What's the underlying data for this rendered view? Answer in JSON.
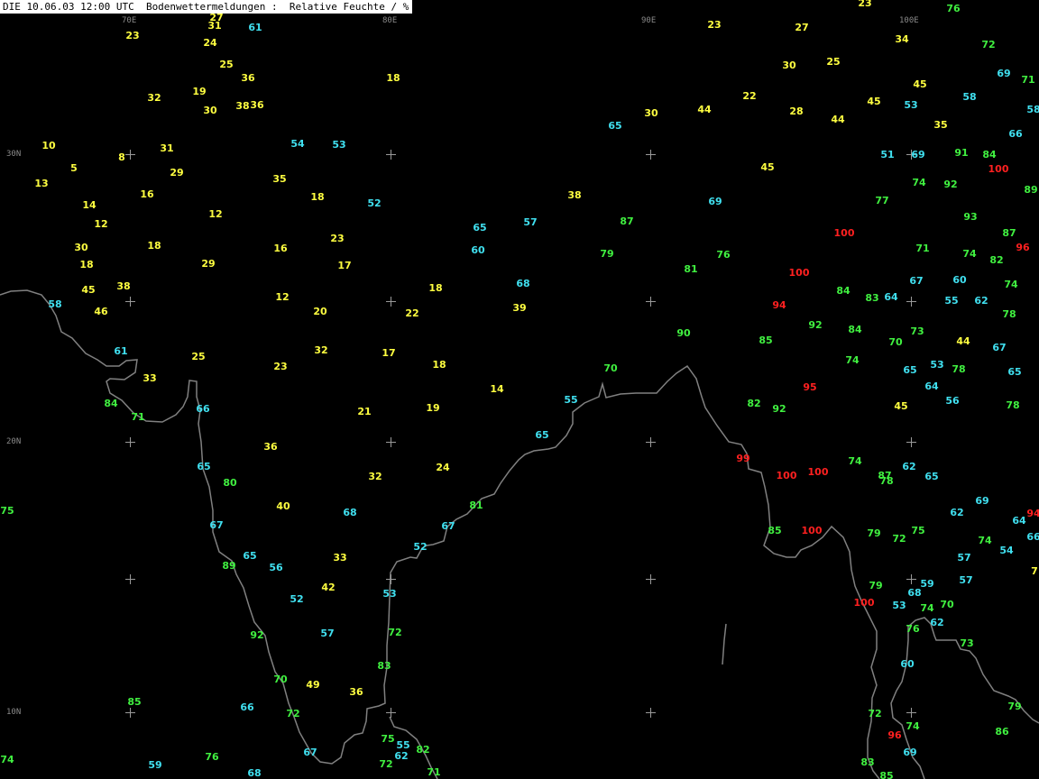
{
  "title": "DIE 10.06.03 12:00 UTC  Bodenwettermeldungen :  Relative Feuchte / %",
  "colors": {
    "background": "#000000",
    "coast": "#808080",
    "grid": "#9a9a9a",
    "label": "#8a8a8a",
    "low": "#ffff40",
    "mid": "#40e0f0",
    "high": "#40f040",
    "sat": "#ff2020"
  },
  "grid_labels": {
    "lon": [
      "70E",
      "80E",
      "90E",
      "100E"
    ],
    "lat": [
      "30N",
      "20N",
      "10N"
    ]
  },
  "observations": [
    [
      "23",
      147,
      40
    ],
    [
      "31",
      238,
      29
    ],
    [
      "27",
      240,
      20
    ],
    [
      "24",
      233,
      48
    ],
    [
      "61",
      283,
      31
    ],
    [
      "25",
      251,
      72
    ],
    [
      "36",
      275,
      87
    ],
    [
      "18",
      436,
      87
    ],
    [
      "32",
      171,
      109
    ],
    [
      "19",
      221,
      102
    ],
    [
      "30",
      233,
      123
    ],
    [
      "38",
      269,
      118
    ],
    [
      "36",
      285,
      117
    ],
    [
      "10",
      54,
      162
    ],
    [
      "5",
      82,
      187
    ],
    [
      "8",
      135,
      175
    ],
    [
      "31",
      185,
      165
    ],
    [
      "29",
      196,
      192
    ],
    [
      "54",
      330,
      160
    ],
    [
      "53",
      376,
      161
    ],
    [
      "13",
      46,
      204
    ],
    [
      "16",
      163,
      216
    ],
    [
      "35",
      310,
      199
    ],
    [
      "18",
      352,
      219
    ],
    [
      "52",
      415,
      226
    ],
    [
      "14",
      99,
      228
    ],
    [
      "12",
      112,
      249
    ],
    [
      "12",
      239,
      238
    ],
    [
      "23",
      374,
      265
    ],
    [
      "30",
      90,
      275
    ],
    [
      "18",
      171,
      273
    ],
    [
      "16",
      311,
      276
    ],
    [
      "18",
      96,
      294
    ],
    [
      "29",
      231,
      293
    ],
    [
      "17",
      382,
      295
    ],
    [
      "45",
      98,
      322
    ],
    [
      "38",
      137,
      318
    ],
    [
      "18",
      483,
      320
    ],
    [
      "12",
      313,
      330
    ],
    [
      "58",
      61,
      338
    ],
    [
      "46",
      112,
      346
    ],
    [
      "20",
      355,
      346
    ],
    [
      "22",
      457,
      348
    ],
    [
      "61",
      134,
      390
    ],
    [
      "25",
      220,
      396
    ],
    [
      "32",
      356,
      389
    ],
    [
      "17",
      431,
      392
    ],
    [
      "33",
      166,
      420
    ],
    [
      "23",
      311,
      407
    ],
    [
      "18",
      487,
      405
    ],
    [
      "84",
      123,
      448
    ],
    [
      "71",
      153,
      463
    ],
    [
      "66",
      225,
      454
    ],
    [
      "21",
      404,
      457
    ],
    [
      "19",
      480,
      453
    ],
    [
      "14",
      551,
      432
    ],
    [
      "36",
      300,
      496
    ],
    [
      "65",
      226,
      518
    ],
    [
      "80",
      255,
      536
    ],
    [
      "32",
      416,
      529
    ],
    [
      "24",
      491,
      519
    ],
    [
      "40",
      314,
      562
    ],
    [
      "68",
      388,
      569
    ],
    [
      "67",
      240,
      583
    ],
    [
      "65",
      277,
      617
    ],
    [
      "56",
      306,
      630
    ],
    [
      "33",
      377,
      619
    ],
    [
      "89",
      254,
      628
    ],
    [
      "42",
      364,
      652
    ],
    [
      "52",
      329,
      665
    ],
    [
      "53",
      432,
      659
    ],
    [
      "92",
      285,
      705
    ],
    [
      "57",
      363,
      703
    ],
    [
      "72",
      438,
      702
    ],
    [
      "83",
      426,
      739
    ],
    [
      "70",
      311,
      754
    ],
    [
      "49",
      347,
      760
    ],
    [
      "36",
      395,
      768
    ],
    [
      "72",
      325,
      792
    ],
    [
      "67",
      344,
      835
    ],
    [
      "75",
      430,
      820
    ],
    [
      "55",
      447,
      827
    ],
    [
      "62",
      445,
      839
    ],
    [
      "82",
      469,
      832
    ],
    [
      "72",
      428,
      848
    ],
    [
      "71",
      481,
      857
    ],
    [
      "68",
      282,
      858
    ],
    [
      "66",
      274,
      785
    ],
    [
      "85",
      149,
      779
    ],
    [
      "76",
      235,
      840
    ],
    [
      "59",
      172,
      849
    ],
    [
      "74",
      8,
      843
    ],
    [
      "75",
      8,
      567
    ],
    [
      "23",
      959,
      4
    ],
    [
      "76",
      1057,
      10
    ],
    [
      "23",
      792,
      28
    ],
    [
      "27",
      889,
      31
    ],
    [
      "34",
      1000,
      44
    ],
    [
      "72",
      1096,
      50
    ],
    [
      "30",
      875,
      73
    ],
    [
      "25",
      924,
      69
    ],
    [
      "69",
      1113,
      82
    ],
    [
      "71",
      1140,
      89
    ],
    [
      "45",
      1020,
      94
    ],
    [
      "22",
      831,
      107
    ],
    [
      "44",
      781,
      122
    ],
    [
      "30",
      722,
      126
    ],
    [
      "28",
      883,
      124
    ],
    [
      "44",
      929,
      133
    ],
    [
      "45",
      969,
      113
    ],
    [
      "53",
      1010,
      117
    ],
    [
      "58",
      1075,
      108
    ],
    [
      "35",
      1043,
      139
    ],
    [
      "65",
      682,
      140
    ],
    [
      "66",
      1126,
      149
    ],
    [
      "58",
      1146,
      122
    ],
    [
      "51",
      984,
      172
    ],
    [
      "69",
      1018,
      172
    ],
    [
      "91",
      1066,
      170
    ],
    [
      "84",
      1097,
      172
    ],
    [
      "100",
      1107,
      188
    ],
    [
      "45",
      851,
      186
    ],
    [
      "74",
      1019,
      203
    ],
    [
      "92",
      1054,
      205
    ],
    [
      "89",
      1143,
      211
    ],
    [
      "69",
      793,
      224
    ],
    [
      "77",
      978,
      223
    ],
    [
      "38",
      637,
      217
    ],
    [
      "87",
      695,
      246
    ],
    [
      "57",
      588,
      247
    ],
    [
      "65",
      532,
      253
    ],
    [
      "93",
      1076,
      241
    ],
    [
      "100",
      936,
      259
    ],
    [
      "87",
      1119,
      259
    ],
    [
      "96",
      1134,
      275
    ],
    [
      "60",
      530,
      278
    ],
    [
      "79",
      673,
      282
    ],
    [
      "76",
      802,
      283
    ],
    [
      "71",
      1023,
      276
    ],
    [
      "74",
      1075,
      282
    ],
    [
      "82",
      1105,
      289
    ],
    [
      "81",
      766,
      299
    ],
    [
      "100",
      886,
      303
    ],
    [
      "67",
      1016,
      312
    ],
    [
      "60",
      1064,
      311
    ],
    [
      "74",
      1121,
      316
    ],
    [
      "68",
      580,
      315
    ],
    [
      "84",
      935,
      323
    ],
    [
      "83",
      967,
      331
    ],
    [
      "64",
      988,
      330
    ],
    [
      "55",
      1055,
      334
    ],
    [
      "62",
      1088,
      334
    ],
    [
      "94",
      864,
      339
    ],
    [
      "39",
      576,
      342
    ],
    [
      "78",
      1119,
      349
    ],
    [
      "92",
      904,
      361
    ],
    [
      "84",
      948,
      366
    ],
    [
      "73",
      1017,
      368
    ],
    [
      "90",
      758,
      370
    ],
    [
      "85",
      849,
      378
    ],
    [
      "70",
      993,
      380
    ],
    [
      "44",
      1068,
      379
    ],
    [
      "67",
      1108,
      386
    ],
    [
      "74",
      945,
      400
    ],
    [
      "65",
      1009,
      411
    ],
    [
      "53",
      1039,
      405
    ],
    [
      "78",
      1063,
      410
    ],
    [
      "65",
      1125,
      413
    ],
    [
      "70",
      677,
      409
    ],
    [
      "95",
      898,
      430
    ],
    [
      "64",
      1033,
      429
    ],
    [
      "56",
      1056,
      445
    ],
    [
      "78",
      1123,
      450
    ],
    [
      "55",
      633,
      444
    ],
    [
      "82",
      836,
      448
    ],
    [
      "92",
      864,
      454
    ],
    [
      "45",
      999,
      451
    ],
    [
      "65",
      601,
      483
    ],
    [
      "99",
      824,
      509
    ],
    [
      "100",
      872,
      528
    ],
    [
      "100",
      907,
      524
    ],
    [
      "74",
      948,
      512
    ],
    [
      "87",
      981,
      528
    ],
    [
      "78",
      983,
      534
    ],
    [
      "62",
      1008,
      518
    ],
    [
      "65",
      1033,
      529
    ],
    [
      "81",
      528,
      561
    ],
    [
      "69",
      1089,
      556
    ],
    [
      "62",
      1061,
      569
    ],
    [
      "94",
      1146,
      570
    ],
    [
      "64",
      1130,
      578
    ],
    [
      "67",
      497,
      584
    ],
    [
      "85",
      859,
      589
    ],
    [
      "100",
      900,
      589
    ],
    [
      "79",
      969,
      592
    ],
    [
      "72",
      997,
      598
    ],
    [
      "75",
      1018,
      589
    ],
    [
      "74",
      1092,
      600
    ],
    [
      "54",
      1116,
      611
    ],
    [
      "66",
      1146,
      596
    ],
    [
      "52",
      466,
      607
    ],
    [
      "57",
      1069,
      619
    ],
    [
      "7",
      1147,
      634
    ],
    [
      "79",
      971,
      650
    ],
    [
      "59",
      1028,
      648
    ],
    [
      "68",
      1014,
      658
    ],
    [
      "57",
      1071,
      644
    ],
    [
      "100",
      958,
      669
    ],
    [
      "53",
      997,
      672
    ],
    [
      "74",
      1028,
      675
    ],
    [
      "70",
      1050,
      671
    ],
    [
      "62",
      1039,
      691
    ],
    [
      "76",
      1012,
      698
    ],
    [
      "73",
      1072,
      714
    ],
    [
      "60",
      1006,
      737
    ],
    [
      "72",
      970,
      792
    ],
    [
      "74",
      1012,
      806
    ],
    [
      "96",
      992,
      816
    ],
    [
      "79",
      1125,
      784
    ],
    [
      "86",
      1111,
      812
    ],
    [
      "69",
      1009,
      835
    ],
    [
      "83",
      962,
      846
    ],
    [
      "85",
      983,
      861
    ]
  ]
}
